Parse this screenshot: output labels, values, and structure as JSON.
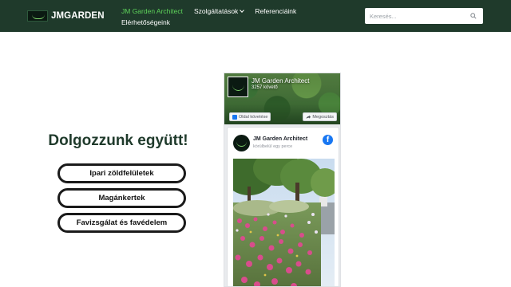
{
  "header": {
    "logo_text": "JMGARDEN",
    "nav": [
      {
        "label": "JM Garden Architect",
        "active": true
      },
      {
        "label": "Szolgáltatások",
        "has_dropdown": true
      },
      {
        "label": "Referenciáink"
      },
      {
        "label": "Elérhetőségeink"
      }
    ],
    "search": {
      "placeholder": "Keresés...",
      "value": ""
    }
  },
  "main": {
    "cta_title": "Dolgozzunk együtt!",
    "buttons": [
      {
        "label": "Ipari zöldfelületek"
      },
      {
        "label": "Magánkertek"
      },
      {
        "label": "Favizsgálat és favédelem"
      }
    ]
  },
  "facebook": {
    "page_name": "JM Garden Architect",
    "followers": "3257 követő",
    "follow_label": "Oldal követése",
    "share_label": "Megosztás",
    "post": {
      "author": "JM Garden Architect",
      "time": "körülbelül egy perce"
    },
    "logo_glyph": "f"
  },
  "colors": {
    "header_bg": "#1f3a2b",
    "nav_active": "#5ed35a",
    "title_color": "#1f3a2b",
    "fb_blue": "#1877f2"
  }
}
